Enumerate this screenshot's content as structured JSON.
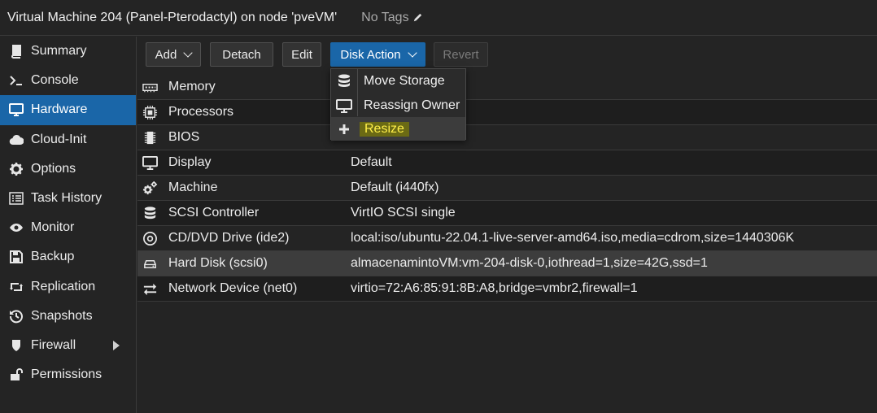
{
  "header": {
    "title": "Virtual Machine 204 (Panel-Pterodactyl) on node 'pveVM'",
    "tags": "No Tags"
  },
  "sidebar": {
    "items": [
      {
        "label": "Summary",
        "icon": "book-icon"
      },
      {
        "label": "Console",
        "icon": "terminal-icon"
      },
      {
        "label": "Hardware",
        "icon": "desktop-icon",
        "active": true
      },
      {
        "label": "Cloud-Init",
        "icon": "cloud-icon"
      },
      {
        "label": "Options",
        "icon": "gear-icon"
      },
      {
        "label": "Task History",
        "icon": "list-icon"
      },
      {
        "label": "Monitor",
        "icon": "eye-icon"
      },
      {
        "label": "Backup",
        "icon": "floppy-icon"
      },
      {
        "label": "Replication",
        "icon": "retweet-icon"
      },
      {
        "label": "Snapshots",
        "icon": "history-icon"
      },
      {
        "label": "Firewall",
        "icon": "shield-icon",
        "expandable": true
      },
      {
        "label": "Permissions",
        "icon": "unlock-icon"
      }
    ]
  },
  "toolbar": {
    "add": "Add",
    "detach": "Detach",
    "edit": "Edit",
    "disk_action": "Disk Action",
    "revert": "Revert"
  },
  "hardware": [
    {
      "name": "Memory",
      "value": "",
      "icon": "memory-icon"
    },
    {
      "name": "Processors",
      "value": "",
      "icon": "cpu-icon"
    },
    {
      "name": "BIOS",
      "value": "",
      "icon": "chip-icon"
    },
    {
      "name": "Display",
      "value": "Default",
      "icon": "monitor-icon"
    },
    {
      "name": "Machine",
      "value": "Default (i440fx)",
      "icon": "cogs-icon"
    },
    {
      "name": "SCSI Controller",
      "value": "VirtIO SCSI single",
      "icon": "database-icon"
    },
    {
      "name": "CD/DVD Drive (ide2)",
      "value": "local:iso/ubuntu-22.04.1-live-server-amd64.iso,media=cdrom,size=1440306K",
      "icon": "disc-icon"
    },
    {
      "name": "Hard Disk (scsi0)",
      "value": "almacenamintoVM:vm-204-disk-0,iothread=1,size=42G,ssd=1",
      "icon": "harddisk-icon",
      "selected": true
    },
    {
      "name": "Network Device (net0)",
      "value": "virtio=72:A6:85:91:8B:A8,bridge=vmbr2,firewall=1",
      "icon": "exchange-icon"
    }
  ],
  "disk_action_menu": [
    {
      "label": "Move Storage",
      "icon": "database-icon"
    },
    {
      "label": "Reassign Owner",
      "icon": "desktop-icon"
    },
    {
      "label": "Resize",
      "icon": "plus-icon",
      "hover": true
    }
  ],
  "colors": {
    "accent": "#1a66a8",
    "background": "#242424",
    "highlight_text": "#ffef4a"
  }
}
